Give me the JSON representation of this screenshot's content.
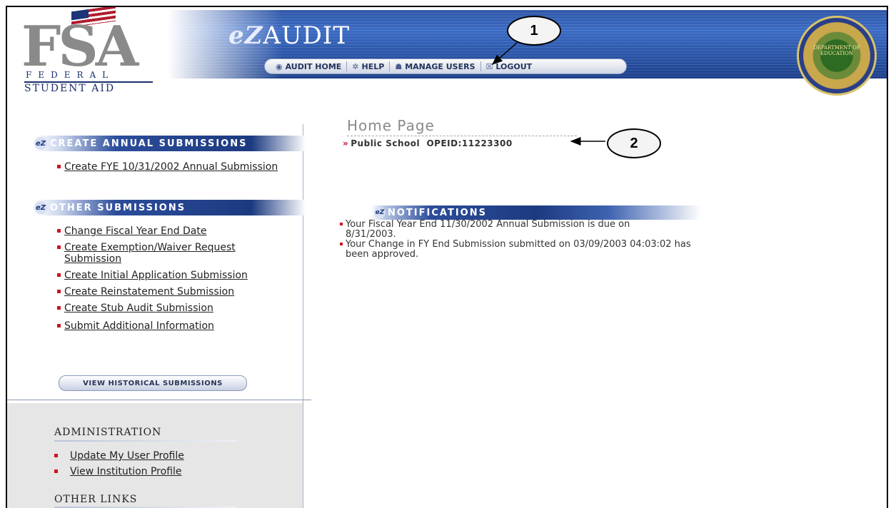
{
  "header": {
    "logo_letters": "FSA",
    "logo_federal": "FEDERAL",
    "logo_student_aid": "STUDENT AID",
    "app_title_ez": "eZ",
    "app_title_audit": "AUDIT",
    "nav": [
      {
        "label": "AUDIT HOME",
        "icon": "ez-icon"
      },
      {
        "label": "HELP",
        "icon": "help-icon"
      },
      {
        "label": "MANAGE USERS",
        "icon": "users-icon"
      },
      {
        "label": "LOGOUT",
        "icon": "logout-icon"
      }
    ],
    "seal_text": "DEPARTMENT OF EDUCATION"
  },
  "callouts": {
    "one": "1",
    "two": "2"
  },
  "sidebar": {
    "annual": {
      "heading": "CREATE ANNUAL SUBMISSIONS",
      "links": [
        "Create FYE 10/31/2002 Annual Submission"
      ]
    },
    "other": {
      "heading": "OTHER SUBMISSIONS",
      "links": [
        "Change Fiscal Year End Date",
        "Create Exemption/Waiver Request Submission",
        "Create Initial Application Submission",
        "Create Reinstatement Submission",
        "Create Stub Audit Submission",
        "Submit Additional Information"
      ]
    },
    "view_historical": "VIEW HISTORICAL SUBMISSIONS",
    "administration": {
      "heading": "ADMINISTRATION",
      "links": [
        "Update My User Profile",
        "View Institution Profile"
      ]
    },
    "other_links": {
      "heading": "OTHER LINKS"
    }
  },
  "main": {
    "page_title": "Home Page",
    "institution_name": "Public School",
    "opeid": "OPEID:11223300",
    "notifications": {
      "heading": "NOTIFICATIONS",
      "items": [
        "Your Fiscal Year End 11/30/2002 Annual Submission is due on 8/31/2003.",
        "Your Change in FY End Submission submitted on 03/09/2003 04:03:02 has been approved."
      ]
    }
  },
  "colors": {
    "brand_blue": "#1c3a80",
    "bullet_red": "#d0121e",
    "sidebar_gray": "#e6e6e6"
  }
}
